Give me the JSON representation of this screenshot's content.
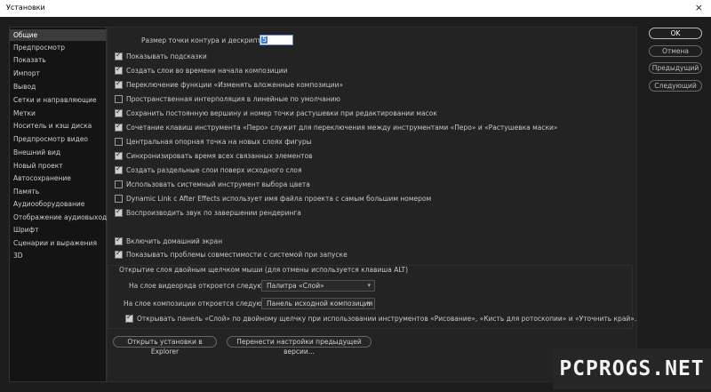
{
  "window": {
    "title": "Установки",
    "close_icon": "×"
  },
  "sidebar": {
    "items": [
      {
        "label": "Общие",
        "selected": true
      },
      {
        "label": "Предпросмотр"
      },
      {
        "label": "Показать"
      },
      {
        "label": "Импорт"
      },
      {
        "label": "Вывод"
      },
      {
        "label": "Сетки и направляющие"
      },
      {
        "label": "Метки"
      },
      {
        "label": "Носитель и кэш диска"
      },
      {
        "label": "Предпросмотр видео"
      },
      {
        "label": "Внешний вид"
      },
      {
        "label": "Новый проект"
      },
      {
        "label": "Автосохранение"
      },
      {
        "label": "Память"
      },
      {
        "label": "Аудиооборудование"
      },
      {
        "label": "Отображение аудиовыхода"
      },
      {
        "label": "Шрифт"
      },
      {
        "label": "Сценарии и выражения"
      },
      {
        "label": "3D"
      }
    ]
  },
  "general": {
    "path_point_label": "Размер точки контура и дескрипторов:",
    "path_point_value": "5",
    "options": [
      {
        "label": "Показывать подсказки",
        "checked": true
      },
      {
        "label": "Создать слои во времени начала композиции",
        "checked": true
      },
      {
        "label": "Переключение функции «Изменять вложенные композиции»",
        "checked": true
      },
      {
        "label": "Пространственная интерполяция в линейные по умолчанию",
        "checked": false
      },
      {
        "label": "Сохранить постоянную вершину и номер точки растушевки при редактировании масок",
        "checked": true
      },
      {
        "label": "Сочетание клавиш инструмента «Перо» служит для переключения между инструментами «Перо» и «Растушевка маски»",
        "checked": true
      },
      {
        "label": "Центральная опорная точка на новых слоях фигуры",
        "checked": false
      },
      {
        "label": "Синхронизировать время всех связанных элементов",
        "checked": true
      },
      {
        "label": "Создать раздельные слои поверх исходного слоя",
        "checked": true
      },
      {
        "label": "Использовать системный инструмент выбора цвета",
        "checked": false
      },
      {
        "label": "Dynamic Link с After Effects использует имя файла проекта с самым большим номером",
        "checked": false
      },
      {
        "label": "Воспроизводить звук по завершении рендеринга",
        "checked": true
      }
    ],
    "options2": [
      {
        "label": "Включить домашний экран",
        "checked": true
      },
      {
        "label": "Показывать проблемы совместимости с системой при запуске",
        "checked": true
      }
    ],
    "double_click_title": "Открытие слоя двойным щелчком мыши (для отмены используется клавиша ALT)",
    "footage_label": "На слое видеоряда откроется следующее:",
    "footage_value": "Палитра «Слой»",
    "comp_label": "На слое композиции откроется следующее:",
    "comp_value": "Панель исходной композиции",
    "layer_panel_option": {
      "label": "Открывать панель «Слой» по двойному щелчку при использовании инструментов «Рисование», «Кисть для ротоскопии» и «Уточнить край».",
      "checked": true
    },
    "reveal_button": "Открыть установки в Explorer",
    "migrate_button": "Перенести настройки предыдущей версии..."
  },
  "buttons": {
    "ok": "OK",
    "cancel": "Отмена",
    "previous": "Предыдущий",
    "next": "Следующий"
  },
  "dropdown_arrow": "▾",
  "watermark": "PCPROGS.NET"
}
